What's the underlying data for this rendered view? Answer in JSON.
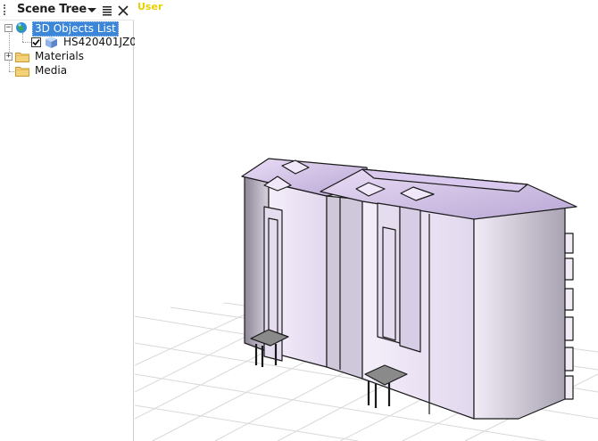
{
  "panel": {
    "title": "Scene Tree",
    "tree": [
      {
        "label": "3D Objects List",
        "selected": true,
        "expanded": true,
        "icon": "globe-icon"
      },
      {
        "label": "HS420401JZ0",
        "checked": true,
        "icon": "cube-icon"
      },
      {
        "label": "Materials",
        "expanded": false,
        "icon": "folder-icon"
      },
      {
        "label": "Media",
        "icon": "folder-icon"
      }
    ]
  },
  "viewport": {
    "label": "User",
    "label_color": "#e8d000"
  },
  "colors": {
    "selection": "#3b86d8",
    "grid": "#d8d8d8",
    "model_shade": "#e9e0f2"
  }
}
